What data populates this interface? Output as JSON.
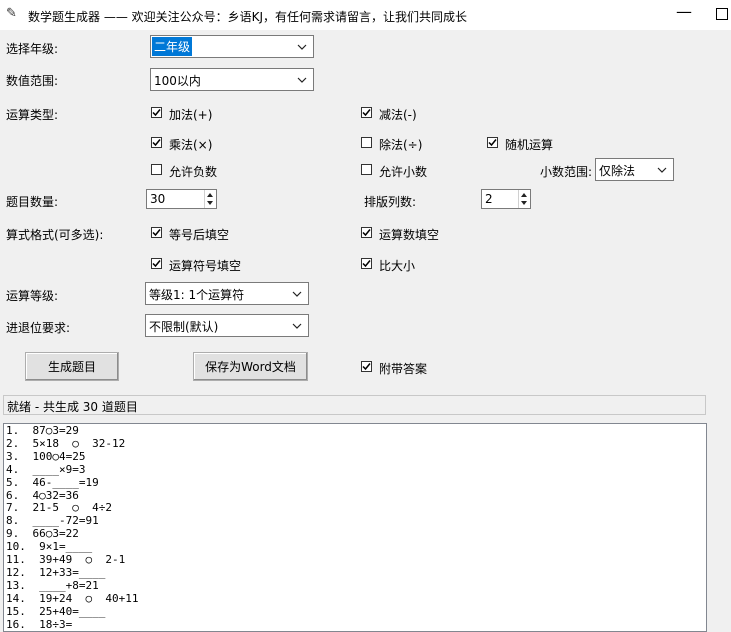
{
  "window": {
    "title": "数学题生成器 —— 欢迎关注公众号：乡语KJ，有任何需求请留言，让我们共同成长",
    "minimize": "—"
  },
  "form": {
    "grade_label": "选择年级:",
    "grade_value": "二年级",
    "range_label": "数值范围:",
    "range_value": "100以内",
    "ops_label": "运算类型:",
    "ops": {
      "add": {
        "label": "加法(+)",
        "checked": true
      },
      "sub": {
        "label": "减法(-)",
        "checked": true
      },
      "mul": {
        "label": "乘法(×)",
        "checked": true
      },
      "div": {
        "label": "除法(÷)",
        "checked": false
      },
      "random": {
        "label": "随机运算",
        "checked": true
      },
      "negative": {
        "label": "允许负数",
        "checked": false
      },
      "decimal": {
        "label": "允许小数",
        "checked": false
      }
    },
    "decimal_range_label": "小数范围:",
    "decimal_range_value": "仅除法",
    "count_label": "题目数量:",
    "count_value": "30",
    "columns_label": "排版列数:",
    "columns_value": "2",
    "format_label": "算式格式(可多选):",
    "formats": {
      "after_eq": {
        "label": "等号后填空",
        "checked": true
      },
      "operand": {
        "label": "运算数填空",
        "checked": true
      },
      "operator": {
        "label": "运算符号填空",
        "checked": true
      },
      "compare": {
        "label": "比大小",
        "checked": true
      }
    },
    "level_label": "运算等级:",
    "level_value": "等级1: 1个运算符",
    "carry_label": "进退位要求:",
    "carry_value": "不限制(默认)"
  },
  "buttons": {
    "generate": "生成题目",
    "save_word": "保存为Word文档",
    "with_answer": {
      "label": "附带答案",
      "checked": true
    }
  },
  "status": "就绪 - 共生成 30 道题目",
  "output_lines": [
    "1.  87○3=29",
    "2.  5×18  ○  32-12",
    "3.  100○4=25",
    "4.  ____×9=3",
    "5.  46-____=19",
    "6.  4○32=36",
    "7.  21-5  ○  4÷2",
    "8.  ____-72=91",
    "9.  66○3=22",
    "10.  9×1=____",
    "11.  39+49  ○  2-1",
    "12.  12+33=____",
    "13.  ____+8=21",
    "14.  19+24  ○  40+11",
    "15.  25+40=____",
    "16.  18÷3="
  ]
}
